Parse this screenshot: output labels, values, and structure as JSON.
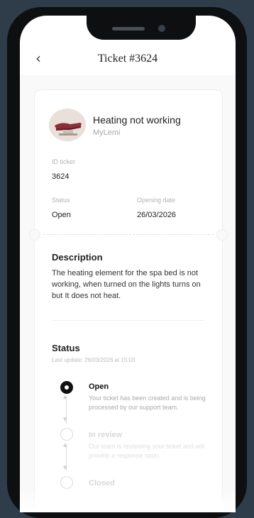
{
  "header": {
    "back_icon": "chevron-left-icon",
    "title": "Ticket #3624"
  },
  "product": {
    "name": "Heating not working",
    "brand": "MyLemi",
    "image_icon": "spa-bed-image"
  },
  "details": {
    "id_label": "ID ticket",
    "id_value": "3624",
    "status_label": "Status",
    "status_value": "Open",
    "date_label": "Opening date",
    "date_value": "26/03/2026"
  },
  "description": {
    "heading": "Description",
    "text": "The heating element for the spa bed is not working, when turned on the lights turns on but It does not heat."
  },
  "status": {
    "heading": "Status",
    "last_update": "Last update: 26/03/2026 at 15:03",
    "steps": [
      {
        "title": "Open",
        "text": "Your ticket has been created and is being processed by our support team.",
        "state": "active"
      },
      {
        "title": "In review",
        "text": "Our team is reviewing your ticket and will provide a response soon.",
        "state": "pending"
      },
      {
        "title": "Closed",
        "text": "",
        "state": "pending"
      }
    ]
  },
  "colors": {
    "background": "#2e3d49",
    "accent": "#111111",
    "muted": "#bdbdbd"
  }
}
